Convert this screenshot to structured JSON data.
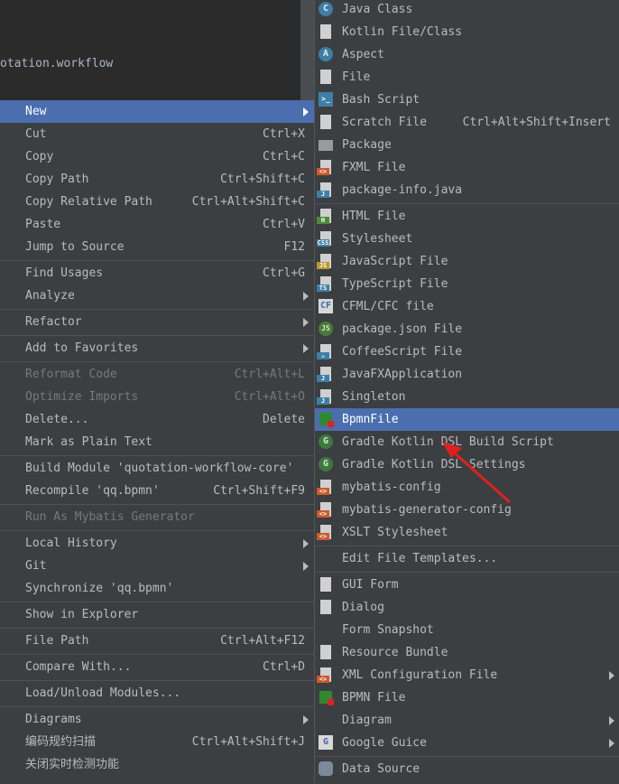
{
  "background": {
    "text": "otation.workflow"
  },
  "left_menu": [
    {
      "label": "New",
      "shortcut": "",
      "submenu": true,
      "selected": true,
      "icon": ""
    },
    {
      "label": "Cut",
      "shortcut": "Ctrl+X",
      "icon": "scissors-icon"
    },
    {
      "label": "Copy",
      "shortcut": "Ctrl+C",
      "icon": "copy-icon"
    },
    {
      "label": "Copy Path",
      "shortcut": "Ctrl+Shift+C",
      "icon": ""
    },
    {
      "label": "Copy Relative Path",
      "shortcut": "Ctrl+Alt+Shift+C",
      "icon": ""
    },
    {
      "label": "Paste",
      "shortcut": "Ctrl+V",
      "icon": "paste-icon"
    },
    {
      "label": "Jump to Source",
      "shortcut": "F12",
      "icon": "edit-icon"
    },
    {
      "separator": true
    },
    {
      "label": "Find Usages",
      "shortcut": "Ctrl+G",
      "icon": ""
    },
    {
      "label": "Analyze",
      "submenu": true,
      "icon": ""
    },
    {
      "separator": true
    },
    {
      "label": "Refactor",
      "submenu": true,
      "icon": ""
    },
    {
      "separator": true
    },
    {
      "label": "Add to Favorites",
      "submenu": true,
      "icon": ""
    },
    {
      "separator": true
    },
    {
      "label": "Reformat Code",
      "shortcut": "Ctrl+Alt+L",
      "disabled": true,
      "icon": ""
    },
    {
      "label": "Optimize Imports",
      "shortcut": "Ctrl+Alt+O",
      "disabled": true,
      "icon": ""
    },
    {
      "label": "Delete...",
      "shortcut": "Delete",
      "icon": ""
    },
    {
      "label": "Mark as Plain Text",
      "icon": "plain-text-icon"
    },
    {
      "separator": true
    },
    {
      "label": "Build Module 'quotation-workflow-core'",
      "icon": ""
    },
    {
      "label": "Recompile 'qq.bpmn'",
      "shortcut": "Ctrl+Shift+F9",
      "icon": ""
    },
    {
      "separator": true
    },
    {
      "label": "Run As Mybatis Generator",
      "disabled": true,
      "icon": "mybatis-icon"
    },
    {
      "separator": true
    },
    {
      "label": "Local History",
      "submenu": true,
      "icon": ""
    },
    {
      "label": "Git",
      "submenu": true,
      "icon": ""
    },
    {
      "label": "Synchronize 'qq.bpmn'",
      "icon": "sync-icon"
    },
    {
      "separator": true
    },
    {
      "label": "Show in Explorer",
      "icon": ""
    },
    {
      "separator": true
    },
    {
      "label": "File Path",
      "shortcut": "Ctrl+Alt+F12",
      "icon": ""
    },
    {
      "separator": true
    },
    {
      "label": "Compare With...",
      "shortcut": "Ctrl+D",
      "icon": "compare-icon"
    },
    {
      "separator": true
    },
    {
      "label": "Load/Unload Modules...",
      "icon": ""
    },
    {
      "separator": true
    },
    {
      "label": "Diagrams",
      "submenu": true,
      "icon": "diagram-icon"
    },
    {
      "label": "编码规约扫描",
      "shortcut": "Ctrl+Alt+Shift+J",
      "icon": "scan-icon"
    },
    {
      "label": "关闭实时检测功能",
      "icon": "disable-icon"
    }
  ],
  "right_menu": [
    {
      "label": "Java Class",
      "icon": "java-class-icon",
      "glyph": "C",
      "kind": "circle"
    },
    {
      "label": "Kotlin File/Class",
      "icon": "kotlin-icon",
      "glyph": "K",
      "kind": "file"
    },
    {
      "label": "Aspect",
      "icon": "aspect-icon",
      "glyph": "A",
      "kind": "circle"
    },
    {
      "label": "File",
      "icon": "file-icon",
      "kind": "file"
    },
    {
      "label": "Bash Script",
      "icon": "bash-icon",
      "glyph": ">_",
      "kind": "term"
    },
    {
      "label": "Scratch File",
      "shortcut": "Ctrl+Alt+Shift+Insert",
      "icon": "scratch-icon",
      "kind": "file"
    },
    {
      "label": "Package",
      "icon": "package-icon",
      "kind": "folder"
    },
    {
      "label": "FXML File",
      "icon": "fxml-icon",
      "tag": "<>",
      "tagcolor": "red",
      "kind": "file"
    },
    {
      "label": "package-info.java",
      "icon": "java-file-icon",
      "tag": "J",
      "tagcolor": "blue",
      "kind": "file"
    },
    {
      "separator": true
    },
    {
      "label": "HTML File",
      "icon": "html-icon",
      "tag": "H",
      "tagcolor": "green",
      "kind": "file"
    },
    {
      "label": "Stylesheet",
      "icon": "css-icon",
      "tag": "CSS",
      "tagcolor": "blue",
      "kind": "file"
    },
    {
      "label": "JavaScript File",
      "icon": "js-icon",
      "tag": "JS",
      "tagcolor": "yellow",
      "kind": "file"
    },
    {
      "label": "TypeScript File",
      "icon": "ts-icon",
      "tag": "TS",
      "tagcolor": "blue",
      "kind": "file"
    },
    {
      "label": "CFML/CFC file",
      "icon": "cf-icon",
      "glyph": "CF",
      "kind": "box"
    },
    {
      "label": "package.json File",
      "icon": "npm-icon",
      "glyph": "JS",
      "kind": "hex"
    },
    {
      "label": "CoffeeScript File",
      "icon": "coffee-icon",
      "tag": "☕",
      "tagcolor": "blue",
      "kind": "file"
    },
    {
      "label": "JavaFXApplication",
      "icon": "javafx-icon",
      "tag": "J",
      "tagcolor": "blue",
      "kind": "file"
    },
    {
      "label": "Singleton",
      "icon": "singleton-icon",
      "tag": "J",
      "tagcolor": "blue",
      "kind": "file"
    },
    {
      "label": "BpmnFile",
      "icon": "bpmn-icon",
      "kind": "bpmn",
      "selected": true
    },
    {
      "label": "Gradle Kotlin DSL Build Script",
      "icon": "gradle-icon",
      "glyph": "G",
      "kind": "green"
    },
    {
      "label": "Gradle Kotlin DSL Settings",
      "icon": "gradle-icon",
      "glyph": "G",
      "kind": "green"
    },
    {
      "label": "mybatis-config",
      "icon": "xml-icon",
      "tag": "<>",
      "tagcolor": "red",
      "kind": "file"
    },
    {
      "label": "mybatis-generator-config",
      "icon": "xml-icon",
      "tag": "<>",
      "tagcolor": "red",
      "kind": "file"
    },
    {
      "label": "XSLT Stylesheet",
      "icon": "xslt-icon",
      "tag": "<>",
      "tagcolor": "red",
      "kind": "file"
    },
    {
      "separator": true
    },
    {
      "label": "Edit File Templates...",
      "icon": ""
    },
    {
      "separator": true
    },
    {
      "label": "GUI Form",
      "icon": "gui-form-icon",
      "kind": "file"
    },
    {
      "label": "Dialog",
      "icon": "dialog-icon",
      "kind": "file"
    },
    {
      "label": "Form Snapshot",
      "icon": ""
    },
    {
      "label": "Resource Bundle",
      "icon": "resource-bundle-icon",
      "kind": "file"
    },
    {
      "label": "XML Configuration File",
      "submenu": true,
      "icon": "xml-icon",
      "tag": "<>",
      "tagcolor": "red",
      "kind": "file"
    },
    {
      "label": "BPMN File",
      "icon": "bpmn-icon",
      "kind": "bpmn"
    },
    {
      "label": "Diagram",
      "submenu": true,
      "icon": ""
    },
    {
      "label": "Google Guice",
      "submenu": true,
      "icon": "guice-icon",
      "glyph": "G",
      "kind": "box"
    },
    {
      "separator": true
    },
    {
      "label": "Data Source",
      "icon": "database-icon",
      "kind": "db"
    }
  ],
  "colors": {
    "selection": "#4b6eaf",
    "background": "#3c3f41",
    "text": "#bbbbbb",
    "arrow": "#e02020"
  }
}
